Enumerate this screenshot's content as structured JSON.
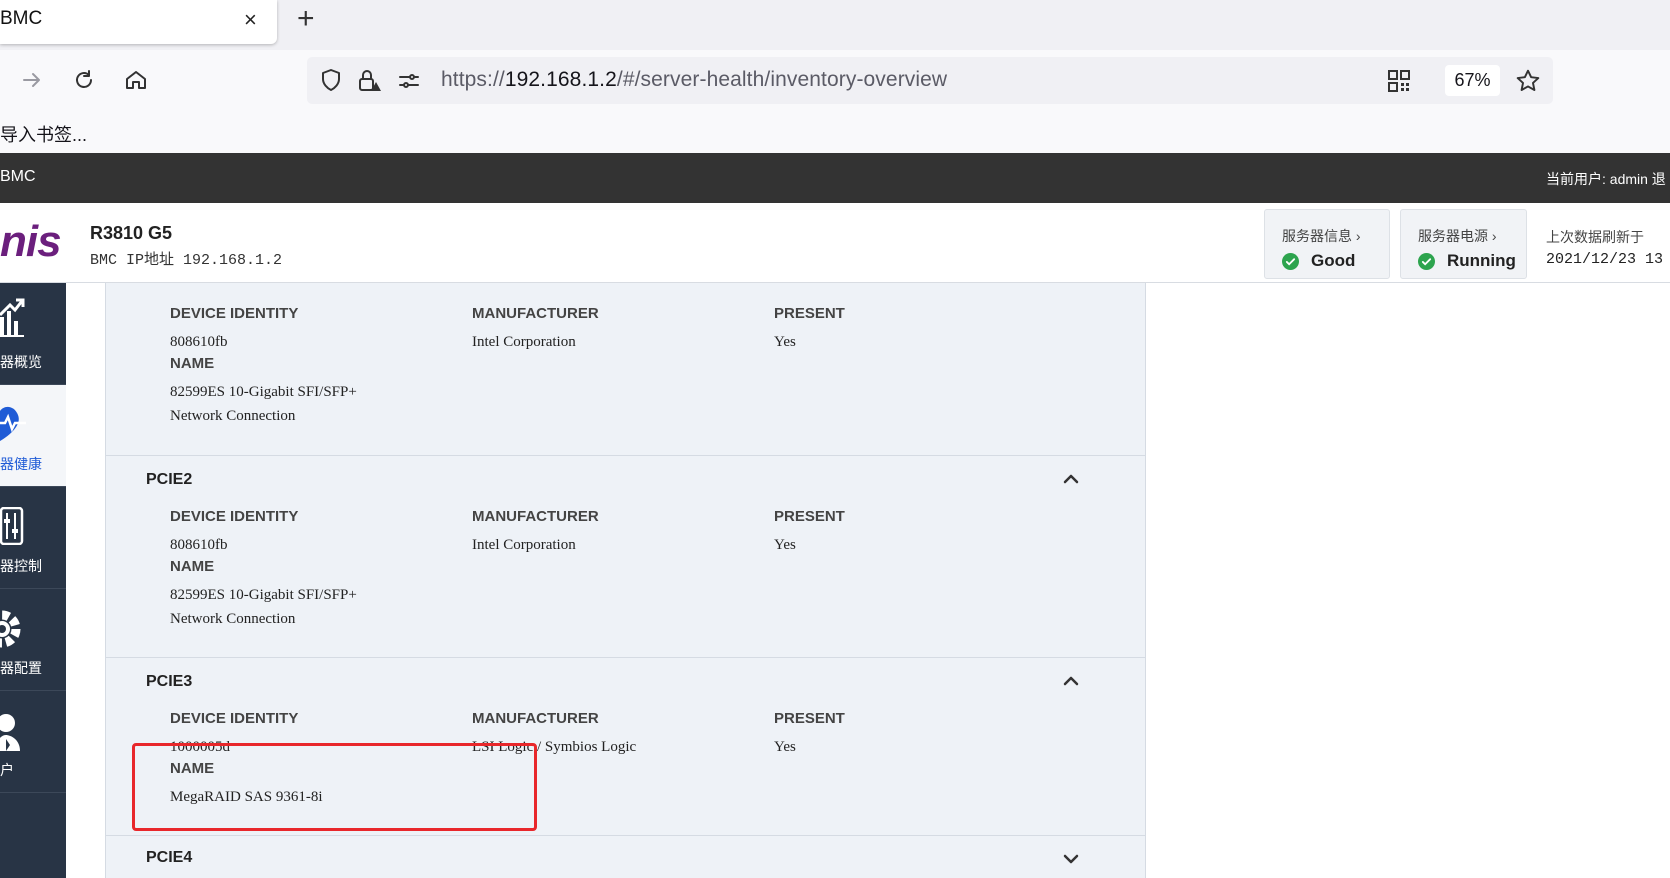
{
  "browser": {
    "tab_title": "BMC",
    "tab_close": "×",
    "new_tab": "+",
    "url_prefix": "https://",
    "url_host": "192.168.1.2",
    "url_path": "/#/server-health/inventory-overview",
    "zoom": "67%",
    "bookmark_text": "导入书签..."
  },
  "app": {
    "title": "BMC",
    "user_info": "当前用户: admin  退",
    "logo": "nis",
    "model": "R3810 G5",
    "bmc_ip": "BMC IP地址 192.168.1.2",
    "server_info_label": "服务器信息",
    "server_info_value": "Good",
    "server_power_label": "服务器电源",
    "server_power_value": "Running",
    "refresh_label": "上次数据刷新于",
    "refresh_time": "2021/12/23 13",
    "status_color": "#2da44e"
  },
  "sidebar": {
    "items": [
      {
        "label": "器概览",
        "icon": "chart-icon"
      },
      {
        "label": "器健康",
        "icon": "heart-pulse-icon"
      },
      {
        "label": "器控制",
        "icon": "control-panel-icon"
      },
      {
        "label": "器配置",
        "icon": "gear-icon"
      },
      {
        "label": "户",
        "icon": "user-icon"
      }
    ]
  },
  "inventory": {
    "headers": {
      "device_identity": "DEVICE IDENTITY",
      "manufacturer": "MANUFACTURER",
      "present": "PRESENT",
      "name": "NAME"
    },
    "pcie1": {
      "device_identity": "808610fb",
      "manufacturer": "Intel Corporation",
      "present": "Yes",
      "name_line1": "82599ES 10-Gigabit SFI/SFP+",
      "name_line2": "Network Connection"
    },
    "pcie2": {
      "title": "PCIE2",
      "device_identity": "808610fb",
      "manufacturer": "Intel Corporation",
      "present": "Yes",
      "name_line1": "82599ES 10-Gigabit SFI/SFP+",
      "name_line2": "Network Connection"
    },
    "pcie3": {
      "title": "PCIE3",
      "device_identity": "1000005d",
      "manufacturer": "LSI Logic / Symbios Logic",
      "present": "Yes",
      "name_line1": "MegaRAID SAS 9361-8i"
    },
    "pcie4": {
      "title": "PCIE4"
    }
  }
}
